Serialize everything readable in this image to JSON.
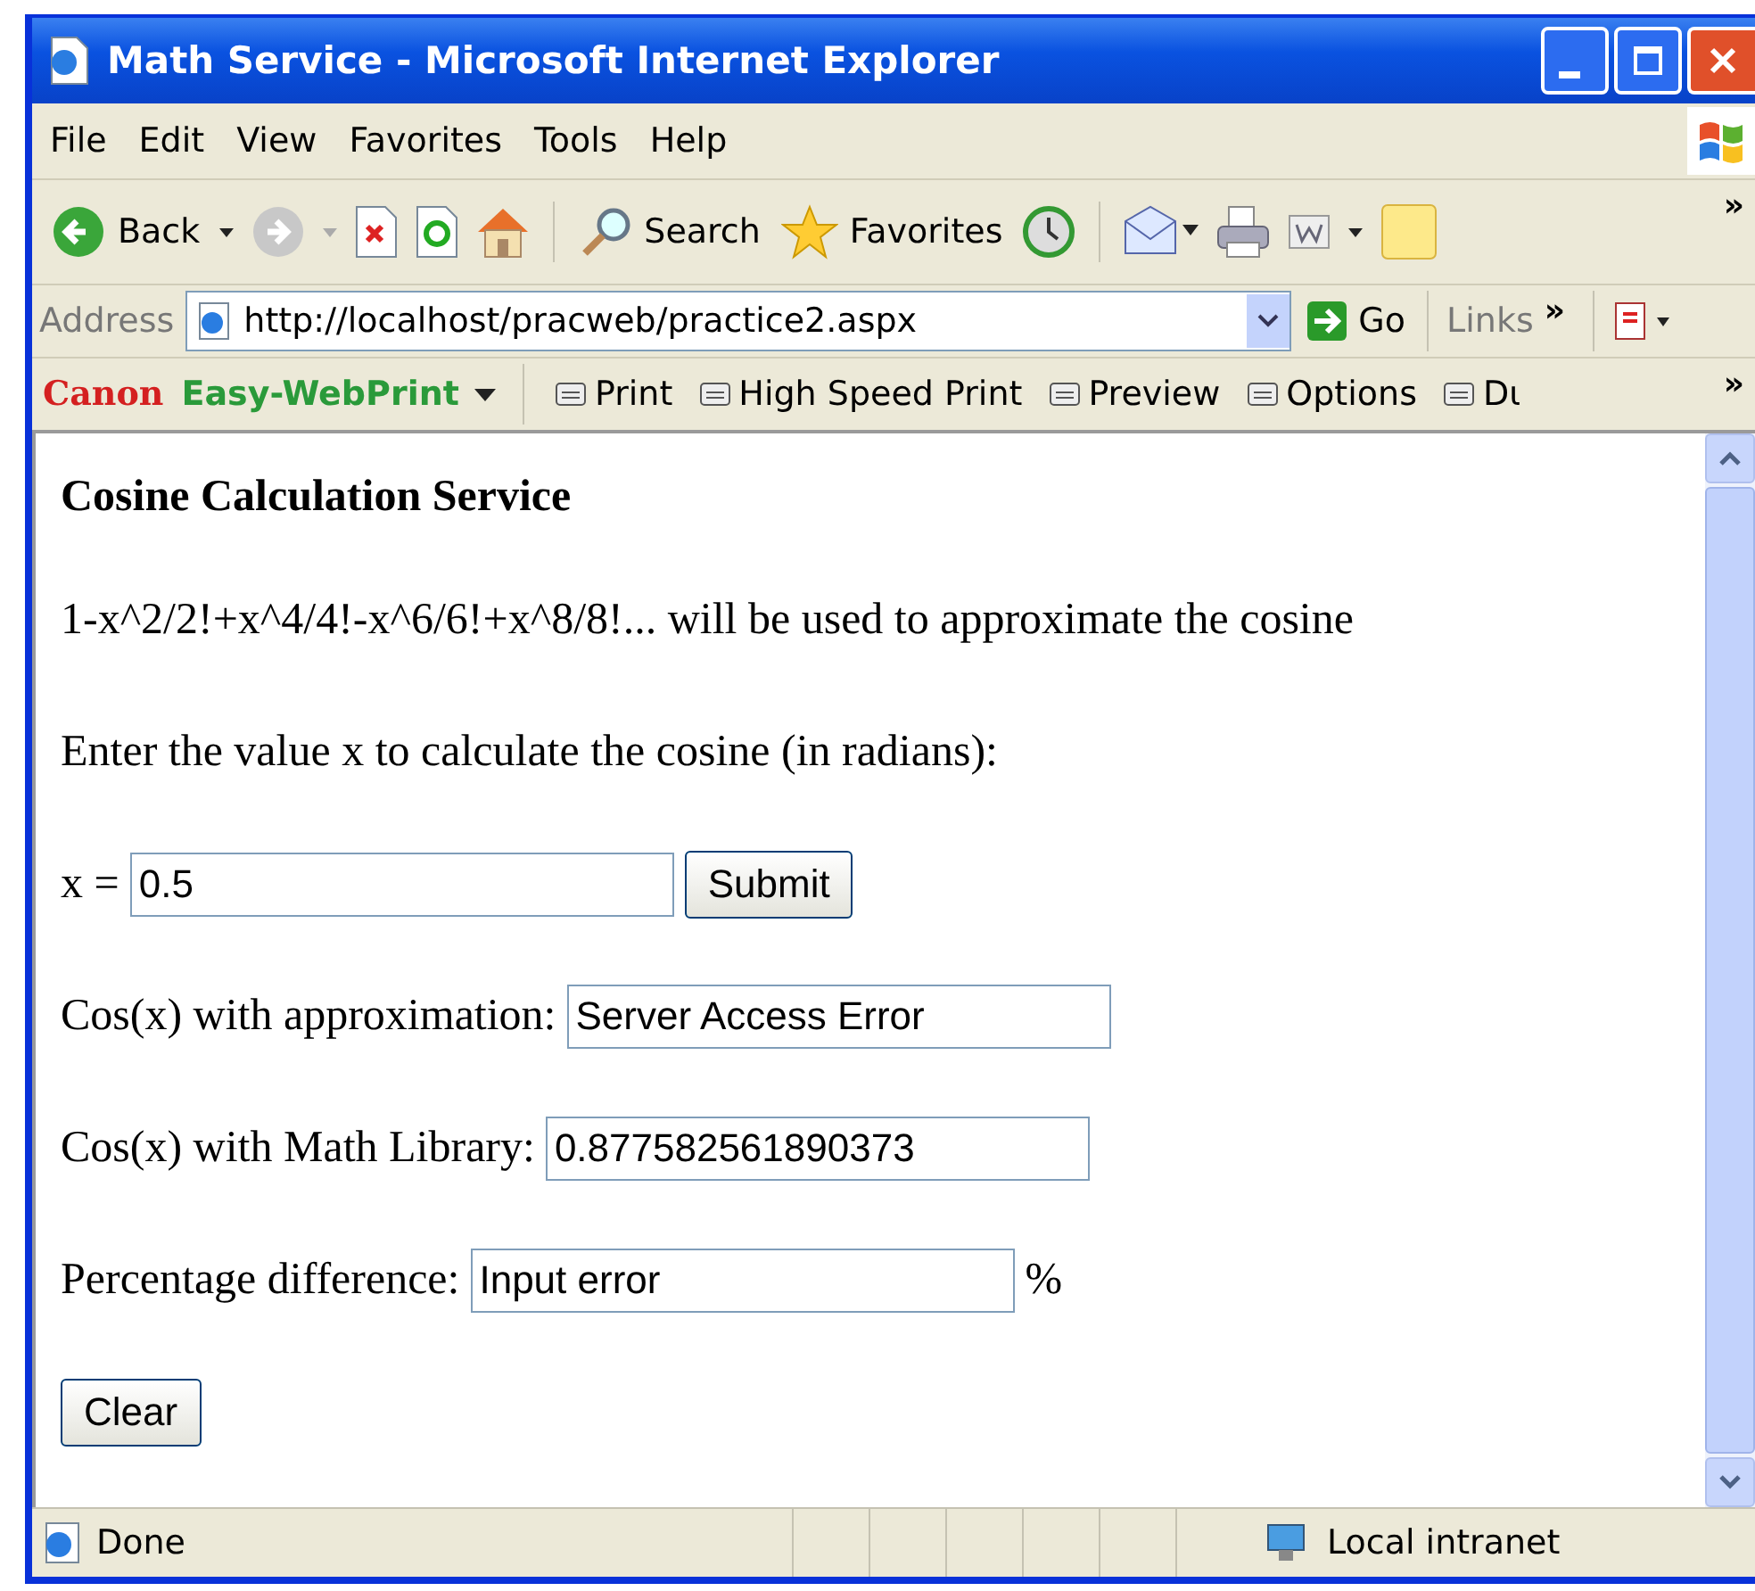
{
  "window": {
    "title": "Math Service - Microsoft Internet Explorer"
  },
  "menu": [
    "File",
    "Edit",
    "View",
    "Favorites",
    "Tools",
    "Help"
  ],
  "toolbar": {
    "back": "Back",
    "forward": {
      "disabled": true
    },
    "search": "Search",
    "favorites": "Favorites",
    "overflow": "»"
  },
  "address_bar": {
    "label": "Address",
    "url": "http://localhost/pracweb/practice2.aspx",
    "go": "Go",
    "links": "Links",
    "overflow": "»"
  },
  "print_toolbar": {
    "brand": "Canon",
    "product": "Easy-WebPrint",
    "items": [
      "Print",
      "High Speed Print",
      "Preview",
      "Options",
      "Dι"
    ],
    "overflow": "»"
  },
  "page": {
    "heading": "Cosine Calculation Service",
    "formula": "1-x^2/2!+x^4/4!-x^6/6!+x^8/8!... will be used to approximate the cosine",
    "prompt": "Enter the value x to calculate the cosine (in radians):",
    "x_label": "x =",
    "x_value": "0.5",
    "submit": "Submit",
    "results": [
      {
        "label": "Cos(x) with approximation:",
        "value": "Server Access Error"
      },
      {
        "label": "Cos(x) with Math Library:",
        "value": "0.877582561890373"
      },
      {
        "label": "Percentage difference:",
        "value": "Input error",
        "suffix": "%"
      }
    ],
    "clear": "Clear"
  },
  "status_bar": {
    "text": "Done",
    "zone": "Local intranet"
  }
}
